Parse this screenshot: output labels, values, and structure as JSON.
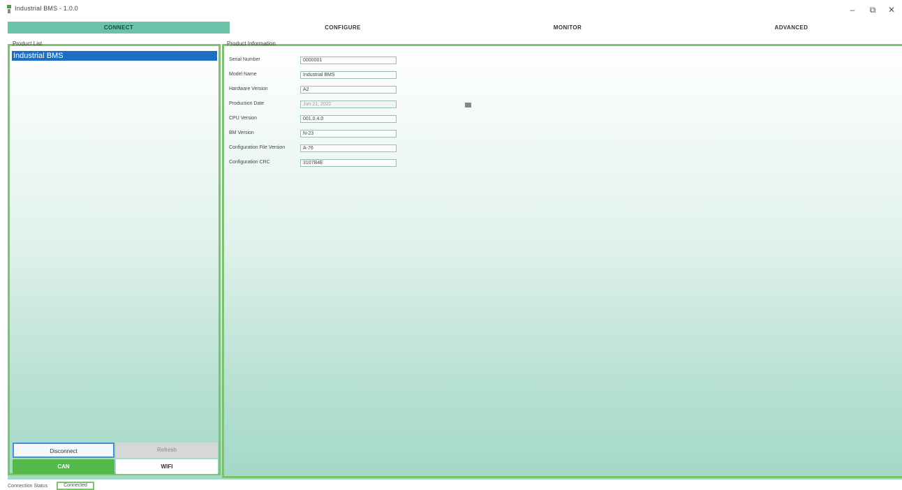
{
  "window": {
    "title": "Industrial BMS - 1.0.0",
    "controls": {
      "minimize": "–",
      "maximize": "⧉",
      "close": "✕"
    }
  },
  "tabs": [
    {
      "label": "CONNECT",
      "active": true
    },
    {
      "label": "CONFIGURE",
      "active": false
    },
    {
      "label": "MONITOR",
      "active": false
    },
    {
      "label": "ADVANCED",
      "active": false
    }
  ],
  "product_list": {
    "title": "Product List",
    "selected_item": "Industrial BMS",
    "buttons": {
      "disconnect": "Disconnect",
      "refresh": "Refresh",
      "can": "CAN",
      "wifi": "WIFI"
    }
  },
  "product_info": {
    "title": "Product Information",
    "fields": [
      {
        "label": "Serial Number",
        "value": "0000001"
      },
      {
        "label": "Model Name",
        "value": "Industrial BMS"
      },
      {
        "label": "Hardware Version",
        "value": "A2"
      },
      {
        "label": "Production Date",
        "value": "Jun 21, 2022"
      },
      {
        "label": "CPU Version",
        "value": "001.0.4.0"
      },
      {
        "label": "BM Version",
        "value": "N-23"
      },
      {
        "label": "Configuration File Version",
        "value": "A-76"
      },
      {
        "label": "Configuration CRC",
        "value": "3107B4E"
      }
    ]
  },
  "status": {
    "label": "Connection Status",
    "value": "Connected"
  },
  "colors": {
    "accent_green": "#79c46c",
    "active_tab": "#6cc2a8",
    "selection_blue": "#1c6fc2",
    "can_button": "#55b84a"
  }
}
